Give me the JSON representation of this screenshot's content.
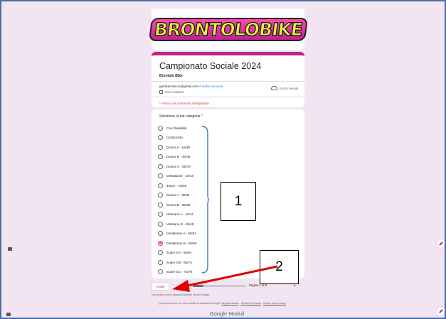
{
  "header": {
    "logo_text": "BRONTOLOBIKE"
  },
  "form": {
    "title": "Campionato Sociale 2024",
    "subtitle": "Brontolo Bike",
    "account_email": "gambacorta.m@gmail.com",
    "switch_account": "Cambia account",
    "not_shared": "Non condiviso",
    "save_draft": "Bozza salvata",
    "required_note": "* Indica una domanda obbligatoria"
  },
  "question": {
    "label": "Seleziona la tua categoria",
    "required_marker": "*",
    "options": [
      {
        "label": "Con Disabilità",
        "checked": false
      },
      {
        "label": "Cicloturista",
        "checked": false
      },
      {
        "label": "Donna A - 15/39",
        "checked": false
      },
      {
        "label": "Donna B - 40/49",
        "checked": false
      },
      {
        "label": "Donna C - 50/79",
        "checked": false
      },
      {
        "label": "Debuttante - 15/18",
        "checked": false
      },
      {
        "label": "Junior - 19/29",
        "checked": false
      },
      {
        "label": "Senior A - 30/34",
        "checked": false
      },
      {
        "label": "Senior B - 35/39",
        "checked": false
      },
      {
        "label": "Veterano A - 40/44",
        "checked": false
      },
      {
        "label": "Veterano B - 45/49",
        "checked": false
      },
      {
        "label": "Gentleman A - 50/54",
        "checked": false
      },
      {
        "label": "Gentleman B - 55/59",
        "checked": true
      },
      {
        "label": "Super GA - 60/64",
        "checked": false
      },
      {
        "label": "Super GB - 65/74",
        "checked": false
      },
      {
        "label": "Super GC - 75/79",
        "checked": false
      }
    ]
  },
  "navigation": {
    "next_label": "Avanti",
    "page_label": "Pagina 1 di 5",
    "page_tail": "a",
    "progress_fraction": 0.2
  },
  "footer": {
    "warning": "Non inviare mai le password tramite Moduli Google.",
    "disclaimer_prefix": "Questi contenuti non sono creati né avallati da Google.",
    "abuse_link": "Segnala abuso",
    "terms_link": "Termini di servizio",
    "privacy_link": "Norme sulla privacy",
    "sep": " - ",
    "brand": "Google Moduli"
  },
  "annotations": {
    "box1": "1",
    "box2": "2",
    "bracket_color": "#4472c4",
    "arrow_color": "#e00000"
  },
  "colors": {
    "accent": "#c2237e",
    "background": "#f3e4f1",
    "frame": "#4a6fa5"
  }
}
